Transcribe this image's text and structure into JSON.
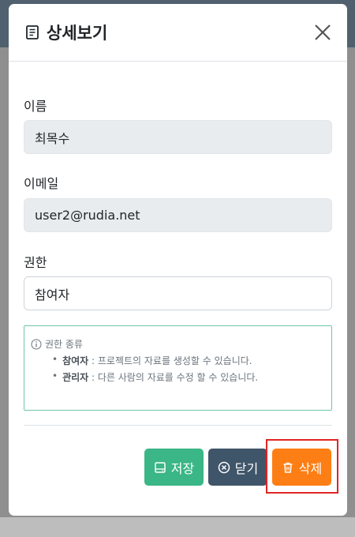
{
  "modal": {
    "title": "상세보기",
    "header_icon": "document-icon",
    "close_icon": "close-icon"
  },
  "form": {
    "name_label": "이름",
    "name_value": "최목수",
    "email_label": "이메일",
    "email_value": "user2@rudia.net",
    "role_label": "권한",
    "role_value": "참여자"
  },
  "info": {
    "icon": "info-icon",
    "title": "권한 종류",
    "items": [
      {
        "term": "참여자",
        "desc": " : 프로젝트의 자료를 생성할 수 있습니다."
      },
      {
        "term": "관리자",
        "desc": " : 다른 사람의 자료를 수정 할 수 있습니다."
      }
    ]
  },
  "buttons": {
    "save_label": "저장",
    "close_label": "닫기",
    "delete_label": "삭제"
  },
  "colors": {
    "save": "#3bb687",
    "close": "#3f5569",
    "delete": "#fd7e14",
    "highlight": "#e02424",
    "info_border": "#6fc5a3"
  }
}
